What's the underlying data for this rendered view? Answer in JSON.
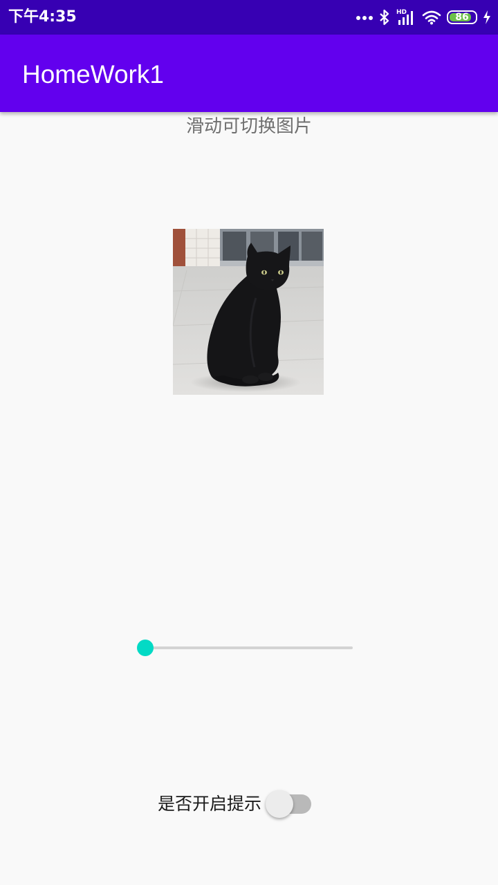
{
  "status_bar": {
    "time": "下午4:35",
    "network_label": "HD",
    "battery": "86",
    "battery_level": 0.86,
    "icons": [
      "more-dots-icon",
      "bluetooth-icon",
      "signal-icon",
      "wifi-icon",
      "battery-icon",
      "charging-icon"
    ]
  },
  "app_bar": {
    "title": "HomeWork1"
  },
  "main": {
    "hint": "滑动可切换图片",
    "image": {
      "subject": "black-cat-photo"
    },
    "slider": {
      "value": 0,
      "min": 0,
      "max": 1
    },
    "switch": {
      "label": "是否开启提示",
      "checked": false
    }
  },
  "colors": {
    "status_bar": "#3700b3",
    "primary": "#6200ee",
    "accent": "#03dac5",
    "background": "#f9f9f9"
  }
}
